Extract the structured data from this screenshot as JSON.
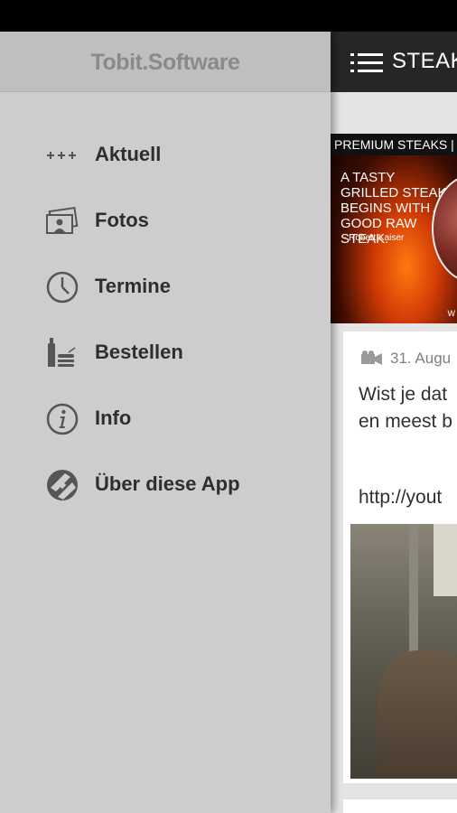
{
  "drawer": {
    "logo_text": "Tobit.Software",
    "items": [
      {
        "label": "Aktuell",
        "icon": "plus-plus-plus-icon"
      },
      {
        "label": "Fotos",
        "icon": "photos-icon"
      },
      {
        "label": "Termine",
        "icon": "clock-icon"
      },
      {
        "label": "Bestellen",
        "icon": "order-icon"
      },
      {
        "label": "Info",
        "icon": "info-icon"
      },
      {
        "label": "Über diese App",
        "icon": "tobit-logo-icon"
      }
    ]
  },
  "content": {
    "actionbar_title": "STEAK",
    "banner": {
      "topline": "PREMIUM STEAKS  |",
      "quote": "A tasty grilled steak begins with a good raw steak.",
      "author": "- Robert Kaiser",
      "small": "W"
    },
    "post": {
      "date": "31. Augu",
      "text_line1": "Wist je dat",
      "text_line2": "en meest b",
      "link": "http://yout"
    }
  },
  "colors": {
    "drawer_bg": "#cdcdcd",
    "drawer_header_bg": "#bfbfbf",
    "actionbar_bg": "#262626",
    "content_bg": "#e4e4e4"
  }
}
